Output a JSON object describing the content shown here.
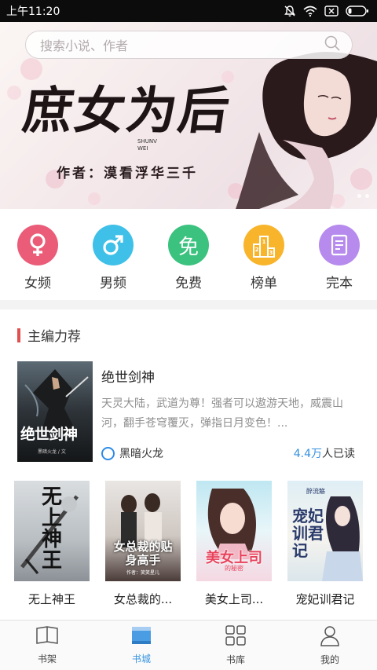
{
  "status_bar": {
    "time": "上午11:20"
  },
  "search": {
    "placeholder": "搜索小说、作者"
  },
  "banner": {
    "title": "庶女为后",
    "subtitle": "SHUNV WEI",
    "author_line": "作者：漠看浮华三千",
    "dot_count": 2
  },
  "categories": [
    {
      "label": "女频",
      "icon": "female-icon",
      "color": "#ea5c78",
      "glyph": "♀"
    },
    {
      "label": "男频",
      "icon": "male-icon",
      "color": "#3fc0e8",
      "glyph": "♂"
    },
    {
      "label": "免费",
      "icon": "free-icon",
      "color": "#3ac27e",
      "glyph": "免"
    },
    {
      "label": "榜单",
      "icon": "ranking-icon",
      "color": "#f8b52c",
      "glyph": ""
    },
    {
      "label": "完本",
      "icon": "completed-book-icon",
      "color": "#b68bed",
      "glyph": ""
    }
  ],
  "section": {
    "title": "主编力荐",
    "accent_color": "#e05050"
  },
  "featured": {
    "title": "绝世剑神",
    "description": "天灵大陆，武道为尊！强者可以遨游天地，威震山河，翻手苍穹覆灭，弹指日月变色！...",
    "author": "黑暗火龙",
    "readers_count": "4.4万",
    "readers_suffix": "人已读",
    "cover_text": "绝世剑神",
    "cover_author": "黑暗火龙 / 文"
  },
  "books": [
    {
      "title": "无上神王",
      "cover_text": "无上神王"
    },
    {
      "title": "女总裁的...",
      "cover_text": "女总裁的贴身高手",
      "cover_author": "作者：笑笑星儿"
    },
    {
      "title": "美女上司...",
      "cover_text": "美女上司",
      "cover_sub": "的秘密"
    },
    {
      "title": "宠妃训君记",
      "cover_text": "宠妃训君记",
      "cover_author": "醉流觞"
    }
  ],
  "bottom_nav": [
    {
      "label": "书架",
      "icon": "bookshelf-icon",
      "active": false
    },
    {
      "label": "书城",
      "icon": "bookstore-icon",
      "active": true
    },
    {
      "label": "书库",
      "icon": "library-grid-icon",
      "active": false
    },
    {
      "label": "我的",
      "icon": "profile-icon",
      "active": false
    }
  ],
  "colors": {
    "accent_blue": "#3592e0"
  }
}
